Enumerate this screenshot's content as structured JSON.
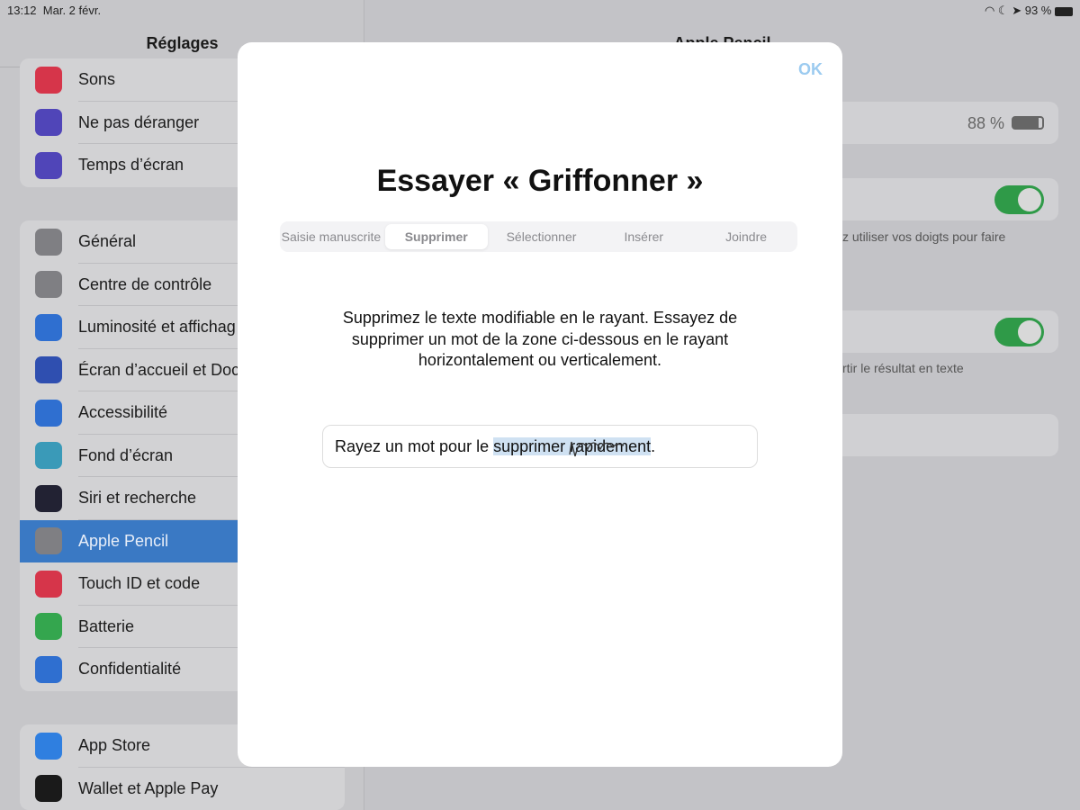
{
  "status": {
    "time": "13:12",
    "date": "Mar. 2 févr.",
    "battery": "93 %"
  },
  "sidebar": {
    "title": "Réglages",
    "groups": [
      [
        {
          "label": "Sons",
          "icon": "speaker-icon",
          "color": "#d6354a"
        },
        {
          "label": "Ne pas déranger",
          "icon": "moon-icon",
          "color": "#5045b8"
        },
        {
          "label": "Temps d’écran",
          "icon": "hourglass-icon",
          "color": "#5045b8"
        }
      ],
      [
        {
          "label": "Général",
          "icon": "gear-icon",
          "color": "#7f7f83"
        },
        {
          "label": "Centre de contrôle",
          "icon": "switches-icon",
          "color": "#7f7f83"
        },
        {
          "label": "Luminosité et affichag",
          "icon": "text-size-icon",
          "color": "#2f6fd0"
        },
        {
          "label": "Écran d’accueil et Doc",
          "icon": "home-grid-icon",
          "color": "#2f4fb0"
        },
        {
          "label": "Accessibilité",
          "icon": "accessibility-icon",
          "color": "#2f6fd0"
        },
        {
          "label": "Fond d’écran",
          "icon": "flower-icon",
          "color": "#3a9ab8"
        },
        {
          "label": "Siri et recherche",
          "icon": "siri-icon",
          "color": "#222233"
        },
        {
          "label": "Apple Pencil",
          "icon": "pencil-icon",
          "color": "#7f7f83",
          "selected": true
        },
        {
          "label": "Touch ID et code",
          "icon": "fingerprint-icon",
          "color": "#d6354a"
        },
        {
          "label": "Batterie",
          "icon": "battery-icon",
          "color": "#34a64e"
        },
        {
          "label": "Confidentialité",
          "icon": "hand-icon",
          "color": "#2f6fd0"
        }
      ],
      [
        {
          "label": "App Store",
          "icon": "app-store-icon",
          "color": "#2f7fe0"
        },
        {
          "label": "Wallet et Apple Pay",
          "icon": "wallet-icon",
          "color": "#1a1a1a"
        }
      ]
    ]
  },
  "detail": {
    "title": "Apple Pencil",
    "pencil_battery": "88 %",
    "footer1": "z utiliser vos doigts pour faire",
    "footer2": "rtir le résultat en texte",
    "toggles": [
      true,
      true
    ]
  },
  "modal": {
    "ok": "OK",
    "title": "Essayer « Griffonner »",
    "tabs": [
      "Saisie manuscrite",
      "Supprimer",
      "Sélectionner",
      "Insérer",
      "Joindre"
    ],
    "active_tab": 1,
    "description": "Supprimez le texte modifiable en le rayant. Essayez de supprimer un mot de la zone ci-dessous en le rayant horizontalement ou verticalement.",
    "field": {
      "before": "Rayez un mot pour le ",
      "selected": "supprimer rapidement",
      "after": "."
    }
  }
}
